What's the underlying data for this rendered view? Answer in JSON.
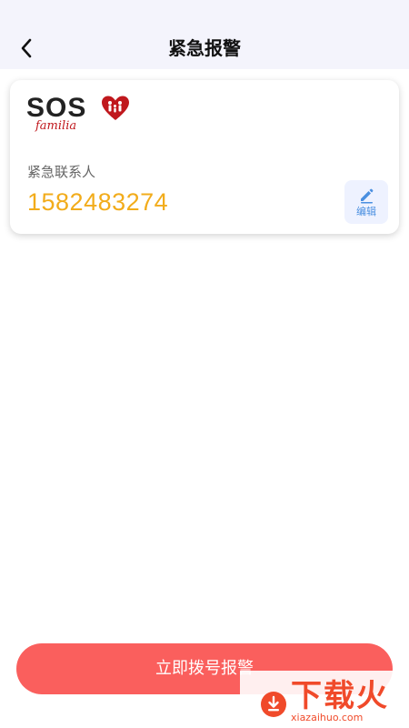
{
  "header": {
    "title": "紧急报警",
    "back_icon": "chevron-left-icon"
  },
  "card": {
    "logo": {
      "brand_text": "SOS",
      "sub_text": "familia",
      "heart_color": "#c0181d"
    },
    "contact_label": "紧急联系人",
    "contact_phone": "1582483274",
    "edit_label": "编辑",
    "edit_icon": "pencil-icon"
  },
  "actions": {
    "call_label": "立即拨号报警"
  },
  "watermark": {
    "text": "下载火",
    "url": "xiazaihuo.com"
  },
  "colors": {
    "header_bg": "#f4f4fc",
    "phone": "#f2ac1b",
    "call_button": "#fa5f5d",
    "edit_button_bg": "#eef2ff",
    "edit_accent": "#4a8fe0"
  }
}
